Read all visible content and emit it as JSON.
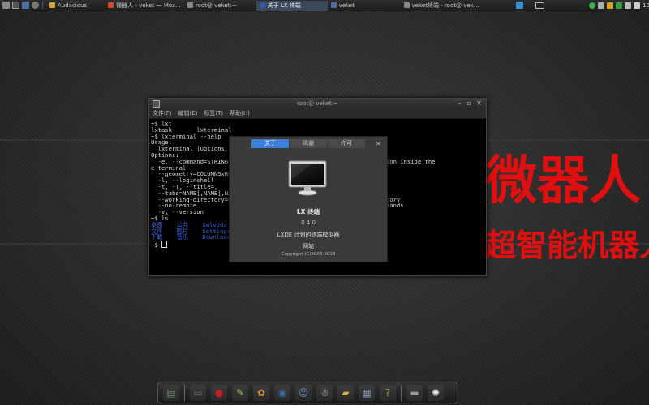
{
  "taskbar": {
    "tasks": [
      {
        "label": "Audacious",
        "color": "#cfa43a"
      },
      {
        "label": "微器人 - veket 一 Moz…",
        "color": "#d24a2a"
      },
      {
        "label": "root@ veket:~",
        "color": "#888888"
      },
      {
        "label": "关于 LX 终端",
        "color": "#2f5f9f"
      },
      {
        "label": "veket",
        "color": "#4a6fa0"
      },
      {
        "label": "veket终端 - root@ vek…",
        "color": "#888888"
      }
    ],
    "clock": "10"
  },
  "wallpaper": {
    "line1": "微器人",
    "line2": "超智能机器人",
    "accent": "#e01010"
  },
  "terminal": {
    "title": "root@ veket:~",
    "menu": [
      "文件(F)",
      "编辑(E)",
      "标签(T)",
      "帮助(H)"
    ],
    "lines": [
      "~$ lxt",
      "lxtask       lxterminal",
      "~$ lxterminal --help",
      "Usage:",
      "  lxterminal [Options...] - LXTerminal is a terminal emulator",
      "",
      "Options:",
      "  -e, --command=STRING             Execute the argument to this option inside the",
      "e terminal",
      "  --geometry=COLUMNSxROWS          Set the terminal's size",
      "  -l, --loginshell                 Execute login shell",
      "  -t, -T, --title=,                Set the terminal's title",
      "  --tabs=NAME[,NAME[,NAME[...]]]   Set the terminal's title",
      "  --working-directory=DIRECTORY    Set the terminal's working directory",
      "  --no-remote                      Do not accept or send remote commands",
      "  -v, --version                    Version information"
    ],
    "prompt_ls": "~$ ls",
    "ls_rows": [
      "桌面    公共    Swlvods                          Templates",
      "文件    图片    Settings                         public",
      "下载    音乐    Downloads"
    ],
    "prompt_last": "~$ "
  },
  "about": {
    "tabs": [
      "关于",
      "鸣谢",
      "许可"
    ],
    "close": "✕",
    "name": "LX 终端",
    "version": "0.4.0",
    "description": "LXDE 计划的终端模拟器",
    "website": "网站",
    "copyright": "Copyright (C)2008-2018",
    "tab_color": "#3a7fd8"
  },
  "dock": {
    "items": [
      {
        "icon": "disk-icon",
        "color": "#6a8f6a",
        "glyph": "▤"
      },
      {
        "icon": "monitor-icon",
        "color": "#4a6f9a",
        "glyph": "▭"
      },
      {
        "icon": "ladybug-icon",
        "color": "#c02020",
        "glyph": "●"
      },
      {
        "icon": "text-editor-icon",
        "color": "#a0c070",
        "glyph": "✎"
      },
      {
        "icon": "paint-palette-icon",
        "color": "#d08a3a",
        "glyph": "✿"
      },
      {
        "icon": "media-player-icon",
        "color": "#3a6fa8",
        "glyph": "◉"
      },
      {
        "icon": "network-users-icon",
        "color": "#5a8ac0",
        "glyph": "☺"
      },
      {
        "icon": "penguin-icon",
        "color": "#e0e0e0",
        "glyph": "☃"
      },
      {
        "icon": "folder-icon",
        "color": "#d8b040",
        "glyph": "▰"
      },
      {
        "icon": "settings-screen-icon",
        "color": "#8a9ab0",
        "glyph": "▦"
      },
      {
        "icon": "help-icon",
        "color": "#b0b040",
        "glyph": "?"
      },
      {
        "icon": "drive-icon",
        "color": "#999999",
        "glyph": "▬"
      },
      {
        "icon": "sun-icon",
        "color": "#e8e8e8",
        "glyph": "✺"
      }
    ]
  }
}
